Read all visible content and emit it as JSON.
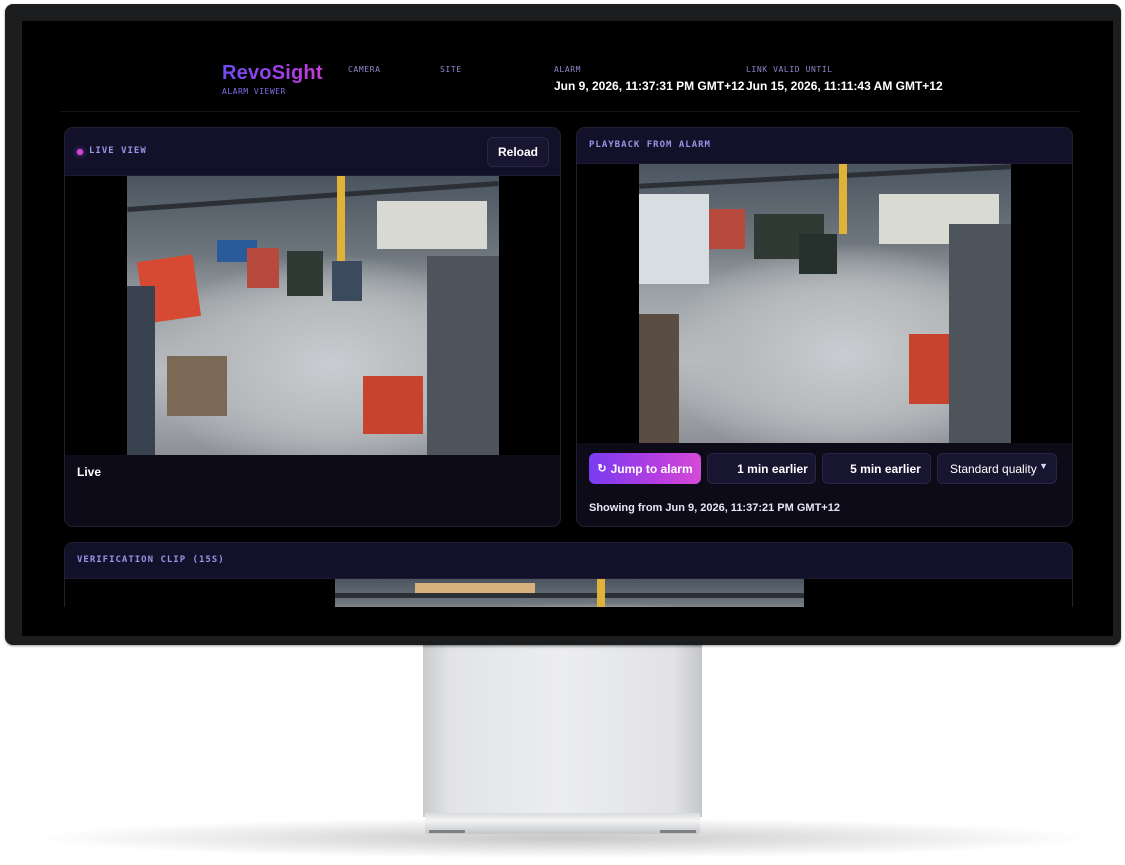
{
  "brand": {
    "name": "RevoSight",
    "subtitle": "ALARM VIEWER"
  },
  "meta": [
    {
      "label": "CAMERA",
      "value": ""
    },
    {
      "label": "SITE",
      "value": ""
    },
    {
      "label": "ALARM",
      "value": "Jun 9, 2026, 11:37:31 PM GMT+12"
    },
    {
      "label": "LINK VALID UNTIL",
      "value": "Jun 15, 2026, 11:11:43 AM GMT+12"
    }
  ],
  "live_panel": {
    "title": "LIVE VIEW",
    "reload_label": "Reload",
    "status": "Live",
    "indicator_color": "#d046d8"
  },
  "playback_panel": {
    "title": "PLAYBACK FROM ALARM",
    "jump_icon": "refresh-icon",
    "jump_label": "Jump to alarm",
    "one_min_label": "1 min earlier",
    "five_min_label": "5 min earlier",
    "quality_selected": "Standard quality",
    "showing_text": "Showing from Jun 9, 2026, 11:37:21 PM GMT+12"
  },
  "clip_panel": {
    "title": "VERIFICATION CLIP (15S)"
  },
  "colors": {
    "accent_purple": "#7a3cf2",
    "accent_magenta": "#d44bd6",
    "panel_bg": "#0d0b17",
    "label_color": "#9b93e6"
  }
}
